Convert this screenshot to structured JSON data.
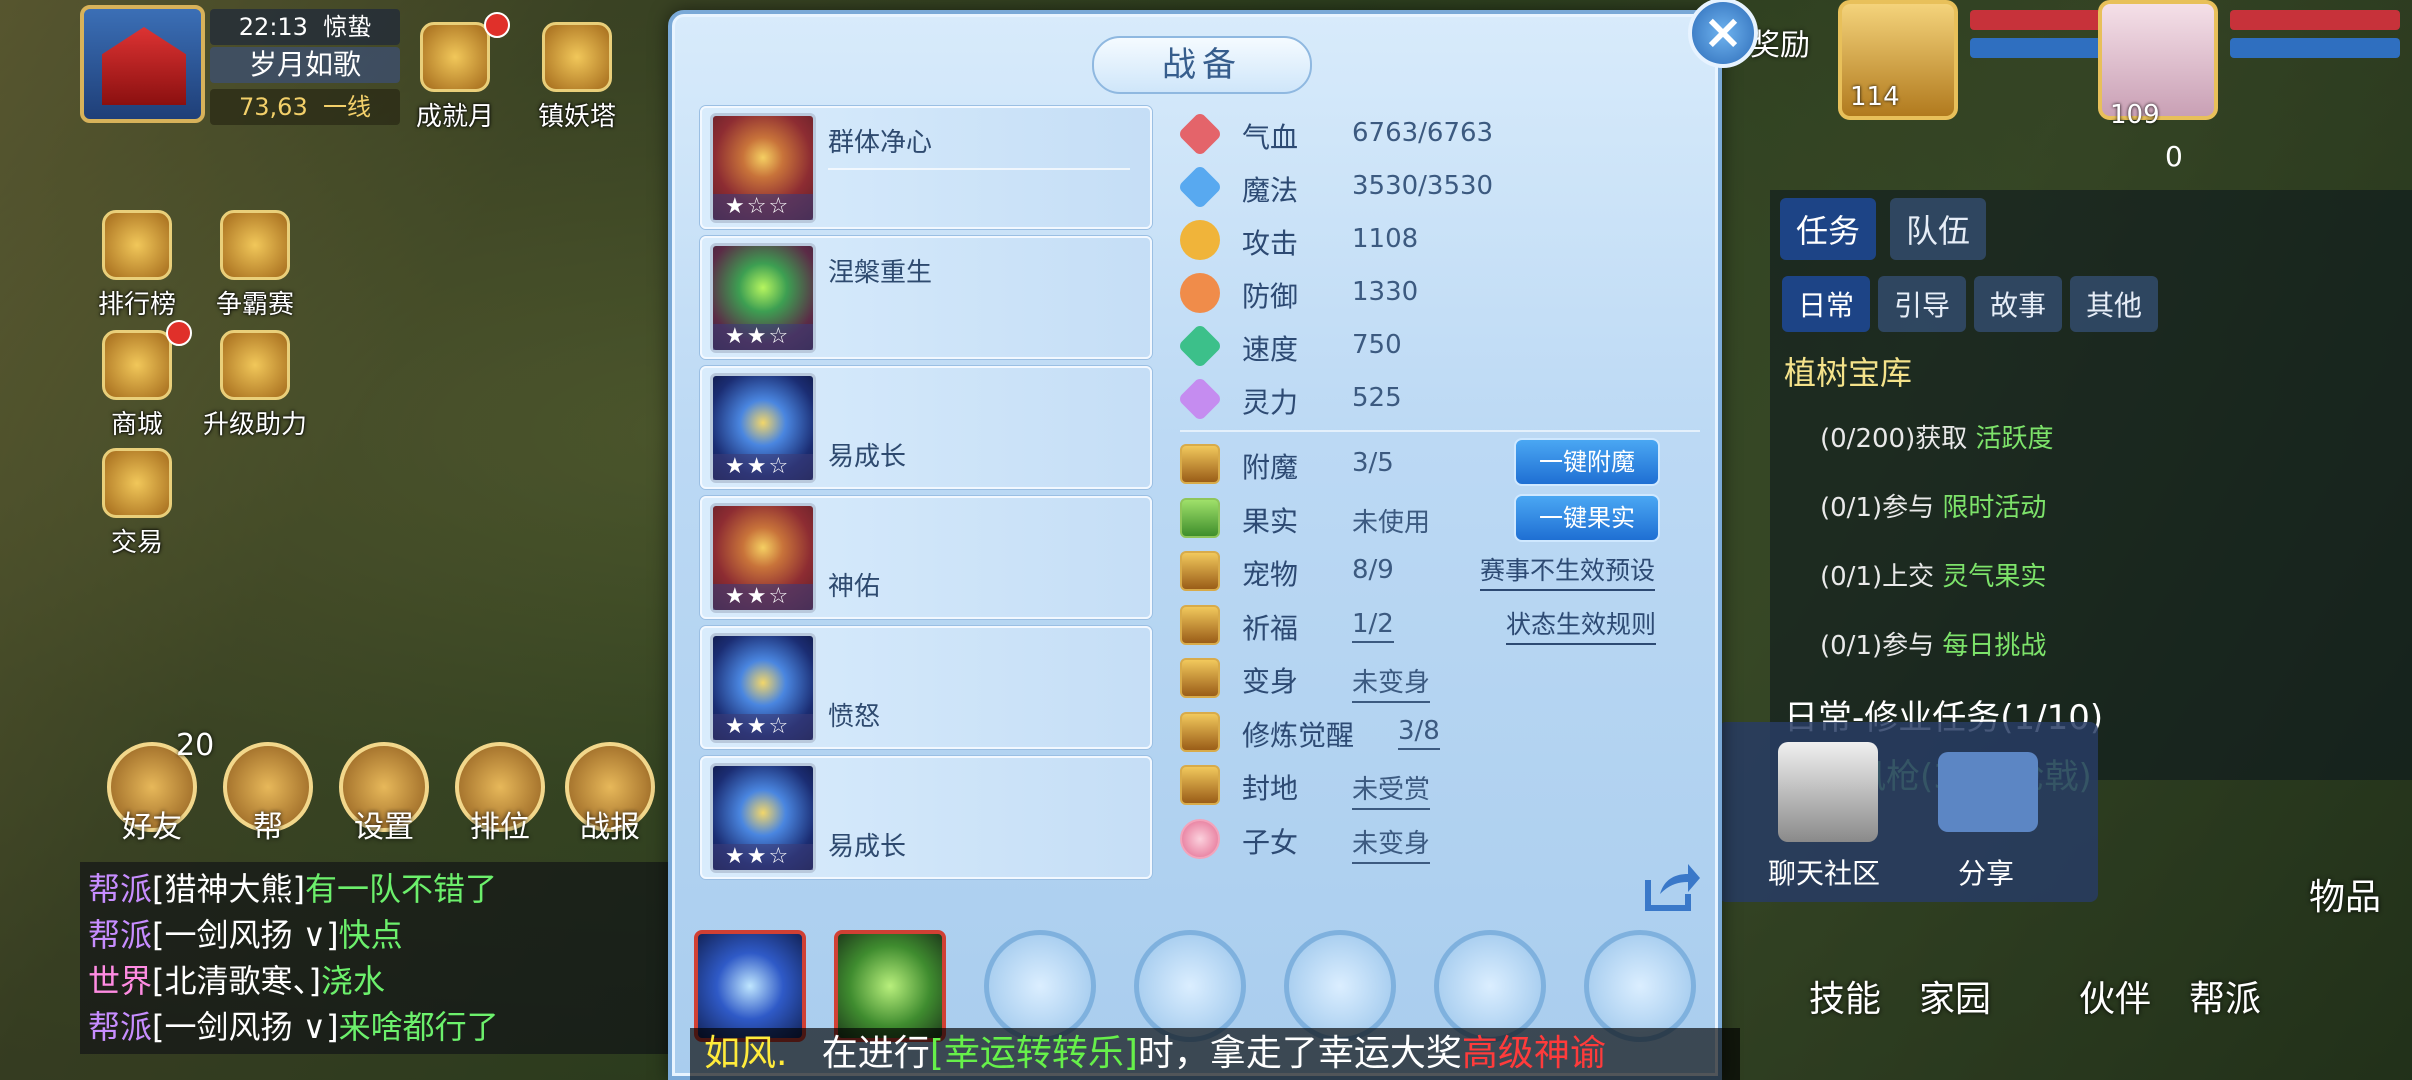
{
  "hud": {
    "time": "22:13",
    "solar_term": "惊蛰",
    "player_name": "岁月如歌",
    "coords": "73,63",
    "line": "一线",
    "top_buttons": [
      "成就月",
      "镇妖塔"
    ],
    "left_buttons": [
      "排行榜",
      "争霸赛",
      "商城",
      "升级助力",
      "交易"
    ],
    "bottom_buttons": [
      "好友",
      "帮",
      "设置",
      "排位",
      "战报"
    ],
    "friend_badge": "20"
  },
  "chat": [
    {
      "channel": "帮派",
      "name": "[猎神大熊]",
      "msg": "有一队不错了"
    },
    {
      "channel": "帮派",
      "name": "[一剑风扬 ∨]",
      "msg": "快点"
    },
    {
      "channel": "世界",
      "name": "[北清歌寒、]",
      "msg": "浇水"
    },
    {
      "channel": "帮派",
      "name": "[一剑风扬 ∨]",
      "msg": "来啥都行了"
    }
  ],
  "right_hud": {
    "reward_label": "奖励",
    "level_left": "114",
    "level_right": "109",
    "hourglass_count": "0",
    "task_tab": "任务",
    "team_tab": "队伍",
    "sub_tabs": [
      "日常",
      "引导",
      "故事",
      "其他"
    ],
    "treasure_title": "植树宝库",
    "tasks": [
      {
        "progress": "(0/200)获取",
        "highlight": "活跃度"
      },
      {
        "progress": "(0/1)参与",
        "highlight": "限时活动"
      },
      {
        "progress": "(0/1)上交",
        "highlight": "灵气果实"
      },
      {
        "progress": "(0/1)参与",
        "highlight": "每日挑战"
      }
    ],
    "mission_title": "日常-修业任务(1/10)",
    "mission_sub": "剑岚风枪(30级枪戟)",
    "share_popup": [
      "聊天社区",
      "分享"
    ],
    "bottom_labels": [
      "物品",
      "技能",
      "家园",
      "伙伴",
      "帮派"
    ]
  },
  "dialog": {
    "title": "战备",
    "close": "×",
    "cards": [
      {
        "name": "群体净心",
        "stars": "★☆☆",
        "icon": "red-whip-icon",
        "name_pos": "top"
      },
      {
        "name": "涅槃重生",
        "stars": "★★☆",
        "icon": "green-phoenix-icon",
        "name_pos": "top"
      },
      {
        "name": "易成长",
        "stars": "★★☆",
        "icon": "blue-spirit-icon",
        "name_pos": "bottom"
      },
      {
        "name": "神佑",
        "stars": "★★☆",
        "icon": "red-ribbon-icon",
        "name_pos": "bottom"
      },
      {
        "name": "愤怒",
        "stars": "★★☆",
        "icon": "blue-cauldron-icon",
        "name_pos": "bottom"
      },
      {
        "name": "易成长",
        "stars": "★★☆",
        "icon": "blue-spirit-icon",
        "name_pos": "bottom"
      }
    ],
    "stats": [
      {
        "label": "气血",
        "value": "6763/6763",
        "color": "#e4646a"
      },
      {
        "label": "魔法",
        "value": "3530/3530",
        "color": "#58a9f0"
      },
      {
        "label": "攻击",
        "value": "1108",
        "color": "#f0b43a"
      },
      {
        "label": "防御",
        "value": "1330",
        "color": "#f08c4a"
      },
      {
        "label": "速度",
        "value": "750",
        "color": "#3cc08a"
      },
      {
        "label": "灵力",
        "value": "525",
        "color": "#c58cf0"
      }
    ],
    "extras": [
      {
        "label": "附魔",
        "value": "3/5"
      },
      {
        "label": "果实",
        "value": "未使用"
      },
      {
        "label": "宠物",
        "value": "8/9"
      },
      {
        "label": "祈福",
        "value": "1/2"
      },
      {
        "label": "变身",
        "value": "未变身"
      },
      {
        "label": "修炼觉醒",
        "value": "3/8"
      },
      {
        "label": "封地",
        "value": "未受赏"
      },
      {
        "label": "子女",
        "value": "未变身"
      }
    ],
    "buttons": {
      "enchant": "一键附魔",
      "fruit": "一键果实",
      "event_preset": "赛事不生效预设",
      "status_rules": "状态生效规则"
    }
  },
  "marquee": {
    "player": "如风.",
    "mid": "在进行",
    "activity": "[幸运转转乐]",
    "mid2": "时，拿走了幸运大奖",
    "prize": "高级神谕"
  }
}
